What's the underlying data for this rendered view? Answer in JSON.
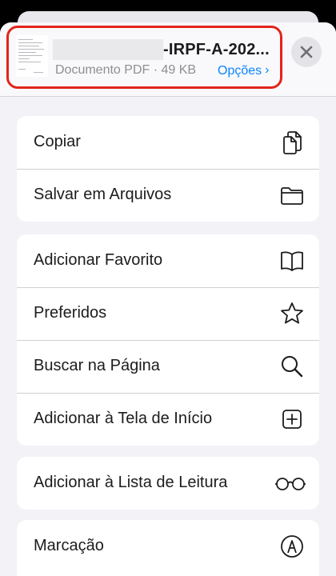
{
  "header": {
    "file_name": "-IRPF-A-202...",
    "file_meta": "Documento PDF · 49 KB",
    "options_label": "Opções",
    "options_chevron": "›",
    "close_icon": "close-icon"
  },
  "highlight_color": "#e3241b",
  "accent_color": "#0a84ff",
  "groups": [
    {
      "items": [
        {
          "label": "Copiar",
          "icon": "copy-icon"
        },
        {
          "label": "Salvar em Arquivos",
          "icon": "folder-icon"
        }
      ]
    },
    {
      "items": [
        {
          "label": "Adicionar Favorito",
          "icon": "book-icon"
        },
        {
          "label": "Preferidos",
          "icon": "star-icon"
        },
        {
          "label": "Buscar na Página",
          "icon": "search-icon"
        },
        {
          "label": "Adicionar à Tela de Início",
          "icon": "plus-square-icon"
        }
      ]
    },
    {
      "items": [
        {
          "label": "Adicionar à Lista de Leitura",
          "icon": "glasses-icon"
        }
      ]
    },
    {
      "items": [
        {
          "label": "Marcação",
          "icon": "markup-icon"
        }
      ]
    }
  ]
}
